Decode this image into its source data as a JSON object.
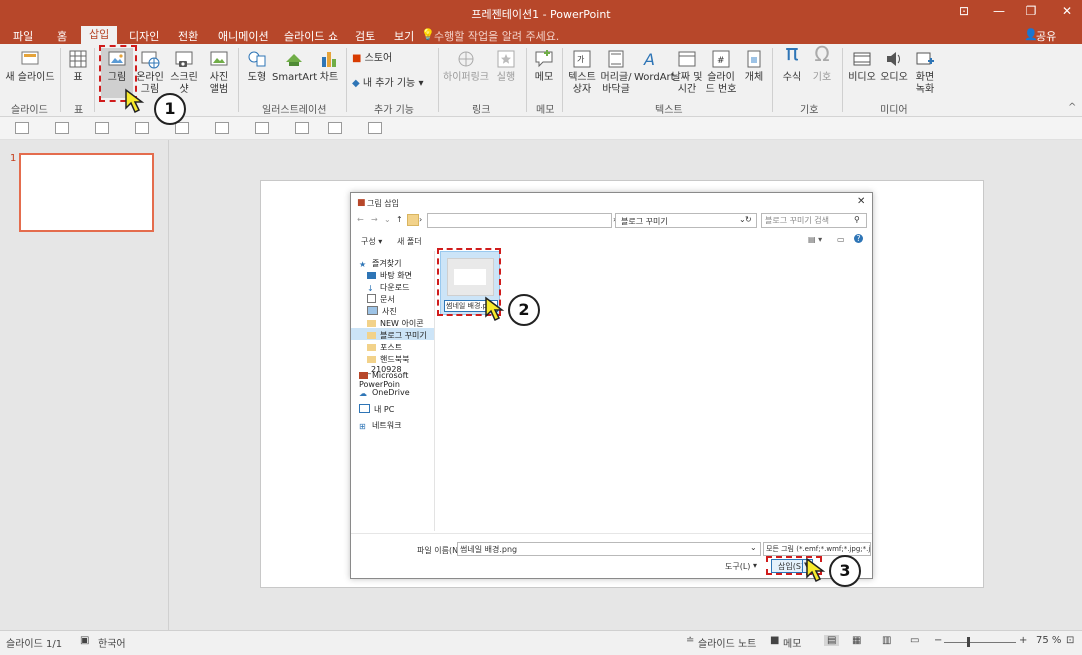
{
  "window": {
    "title": "프레젠테이션1 - PowerPoint",
    "controls": [
      "⊡",
      "—",
      "❐",
      "✕"
    ]
  },
  "tabs": [
    {
      "label": "파일"
    },
    {
      "label": "홈"
    },
    {
      "label": "삽입"
    },
    {
      "label": "디자인"
    },
    {
      "label": "전환"
    },
    {
      "label": "애니메이션"
    },
    {
      "label": "슬라이드 쇼"
    },
    {
      "label": "검토"
    },
    {
      "label": "보기"
    }
  ],
  "tell_me": "수행할 작업을 알려 주세요.",
  "share": "공유",
  "ribbon": {
    "new_slide": "새 슬라이드",
    "table": "표",
    "picture": "그림",
    "online_picture": "온라인 그림",
    "screenshot": "스크린샷",
    "photo_album": "사진 앨범",
    "shapes": "도형",
    "smartart": "SmartArt",
    "chart": "차트",
    "store": "스토어",
    "my_addins": "내 추가 기능",
    "hyperlink": "하이퍼링크",
    "action": "실행",
    "comment": "메모",
    "textbox": "텍스트 상자",
    "header_footer": "머리글/ 바닥글",
    "wordart": "WordArt",
    "date_time": "날짜 및 시간",
    "slide_number": "슬라이드 번호",
    "object": "개체",
    "equation": "수식",
    "symbol": "기호",
    "video": "비디오",
    "audio": "오디오",
    "screen_recording": "화면 녹화",
    "groups": {
      "slides": "슬라이드",
      "tables": "표",
      "illustrations": "일러스트레이션",
      "addins": "추가 기능",
      "links": "링크",
      "comments": "메모",
      "text": "텍스트",
      "symbols": "기호",
      "media": "미디어"
    }
  },
  "thumbnail": {
    "number": "1"
  },
  "dialog": {
    "title": "그림 삽입",
    "breadcrumb": "블로그 꾸미기",
    "search_placeholder": "블로그 꾸미기 검색",
    "organize": "구성 ▾",
    "new_folder": "새 폴더",
    "nav": [
      {
        "label": "즐겨찾기"
      },
      {
        "label": "바탕 화면"
      },
      {
        "label": "다운로드"
      },
      {
        "label": "문서"
      },
      {
        "label": "사진"
      },
      {
        "label": "NEW 아이콘"
      },
      {
        "label": "블로그 꾸미기"
      },
      {
        "label": "포스트"
      },
      {
        "label": "핸드북북_210928"
      },
      {
        "label": "Microsoft PowerPoin"
      },
      {
        "label": "OneDrive"
      },
      {
        "label": "내 PC"
      },
      {
        "label": "네트워크"
      }
    ],
    "file_item": "썸네일 배경.png",
    "filename_label": "파일 이름(N):",
    "filename_value": "썸네일 배경.png",
    "filetype": "모든 그림 (*.emf;*.wmf;*.jpg;*.jpeg;*.j",
    "tools": "도구(L)",
    "insert": "삽입(S)"
  },
  "annotations": [
    "1",
    "2",
    "3"
  ],
  "status": {
    "slide": "슬라이드 1/1",
    "language": "한국어",
    "notes": "슬라이드 노트",
    "comments": "메모",
    "zoom": "75 %"
  },
  "colors": {
    "accent": "#b7472a",
    "annotation": "#d01c1c",
    "cursor": "#f7ea2c"
  }
}
